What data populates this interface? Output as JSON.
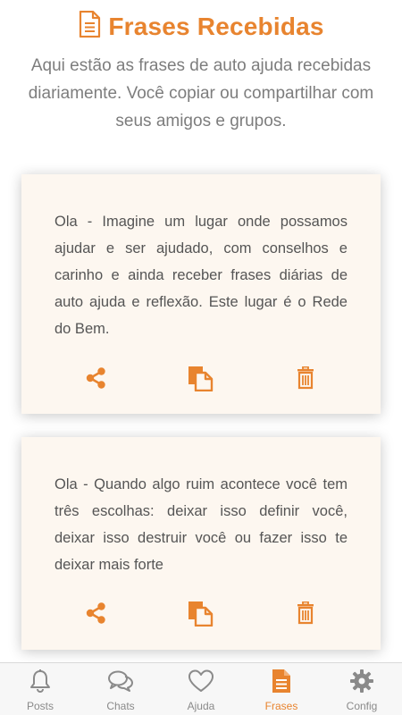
{
  "header": {
    "title": "Frases Recebidas",
    "icon": "document-icon",
    "accent_color": "#e8842f"
  },
  "subtitle": "Aqui estão as frases de auto ajuda recebidas diariamente. Você copiar ou compartilhar com seus amigos e grupos.",
  "cards": [
    {
      "text": "Ola - Imagine um lugar onde possamos ajudar e ser ajudado, com conselhos e carinho e ainda receber frases diárias de auto ajuda e reflexão. Este lugar é o Rede do Bem.",
      "actions": [
        "share-icon",
        "copy-icon",
        "trash-icon"
      ]
    },
    {
      "text": "Ola - Quando algo ruim acontece você tem três escolhas: deixar isso definir você, deixar isso destruir você ou fazer isso te deixar mais forte",
      "actions": [
        "share-icon",
        "copy-icon",
        "trash-icon"
      ]
    }
  ],
  "tabbar": {
    "items": [
      {
        "label": "Posts",
        "icon": "bell-icon",
        "active": false
      },
      {
        "label": "Chats",
        "icon": "chat-bubbles-icon",
        "active": false
      },
      {
        "label": "Ajuda",
        "icon": "heart-icon",
        "active": false
      },
      {
        "label": "Frases",
        "icon": "document-icon",
        "active": true
      },
      {
        "label": "Config",
        "icon": "gear-icon",
        "active": false
      }
    ],
    "active_color": "#e8842f",
    "inactive_color": "#8a8a8a"
  }
}
